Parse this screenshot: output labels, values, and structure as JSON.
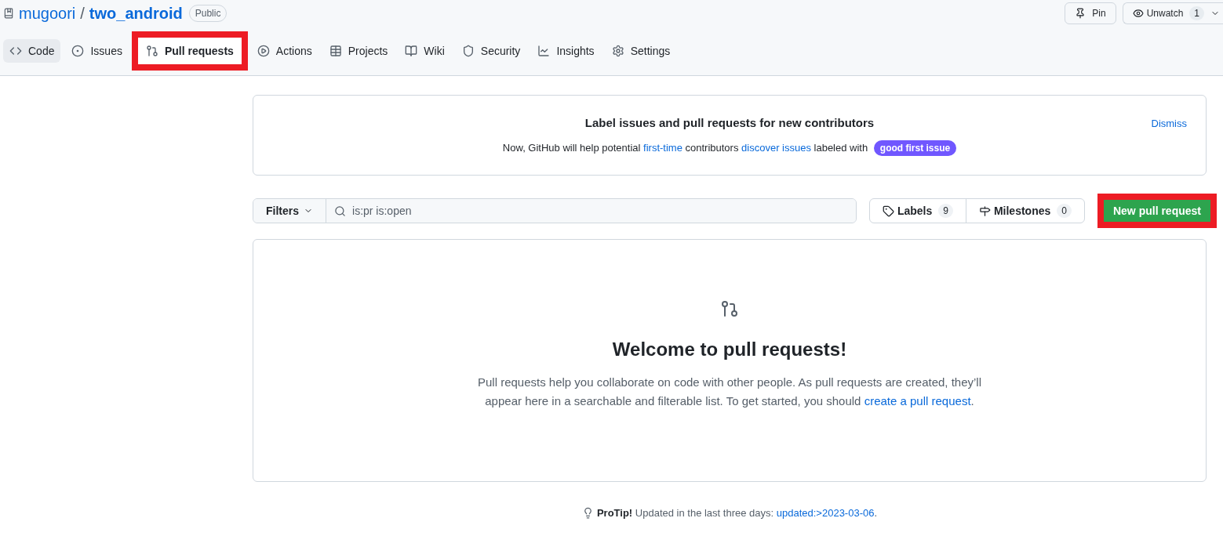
{
  "repo": {
    "owner": "mugoori",
    "separator": "/",
    "name": "two_android",
    "visibility": "Public"
  },
  "header_actions": [
    {
      "kind": "pin",
      "label": "Pin"
    },
    {
      "kind": "watch",
      "label": "Unwatch",
      "count": "1"
    }
  ],
  "tabs": [
    {
      "kind": "code",
      "label": "Code",
      "selected": true,
      "highlighted": false
    },
    {
      "kind": "issue",
      "label": "Issues",
      "selected": false,
      "highlighted": false
    },
    {
      "kind": "pr",
      "label": "Pull requests",
      "selected": false,
      "highlighted": true
    },
    {
      "kind": "play",
      "label": "Actions",
      "selected": false,
      "highlighted": false
    },
    {
      "kind": "table",
      "label": "Projects",
      "selected": false,
      "highlighted": false
    },
    {
      "kind": "book",
      "label": "Wiki",
      "selected": false,
      "highlighted": false
    },
    {
      "kind": "shield",
      "label": "Security",
      "selected": false,
      "highlighted": false
    },
    {
      "kind": "graph",
      "label": "Insights",
      "selected": false,
      "highlighted": false
    },
    {
      "kind": "gear",
      "label": "Settings",
      "selected": false,
      "highlighted": false
    }
  ],
  "banner": {
    "title": "Label issues and pull requests for new contributors",
    "dismiss": "Dismiss",
    "text_1": "Now, GitHub will help potential ",
    "link_1": "first-time",
    "text_2": " contributors ",
    "link_2": "discover issues",
    "text_3": " labeled with ",
    "label": "good first issue"
  },
  "toolbar": {
    "filters": "Filters",
    "search_value": "is:pr is:open",
    "labels": "Labels",
    "labels_count": "9",
    "milestones": "Milestones",
    "milestones_count": "0",
    "new_button": "New pull request",
    "new_button_highlighted": true
  },
  "blankslate": {
    "title": "Welcome to pull requests!",
    "text": "Pull requests help you collaborate on code with other people. As pull requests are created, they’ll appear here in a searchable and filterable list. To get started, you should ",
    "link": "create a pull request",
    "end": "."
  },
  "protip": {
    "label": "ProTip!",
    "text": " Updated in the last three days: ",
    "link": "updated:>2023-03-06",
    "end": "."
  }
}
